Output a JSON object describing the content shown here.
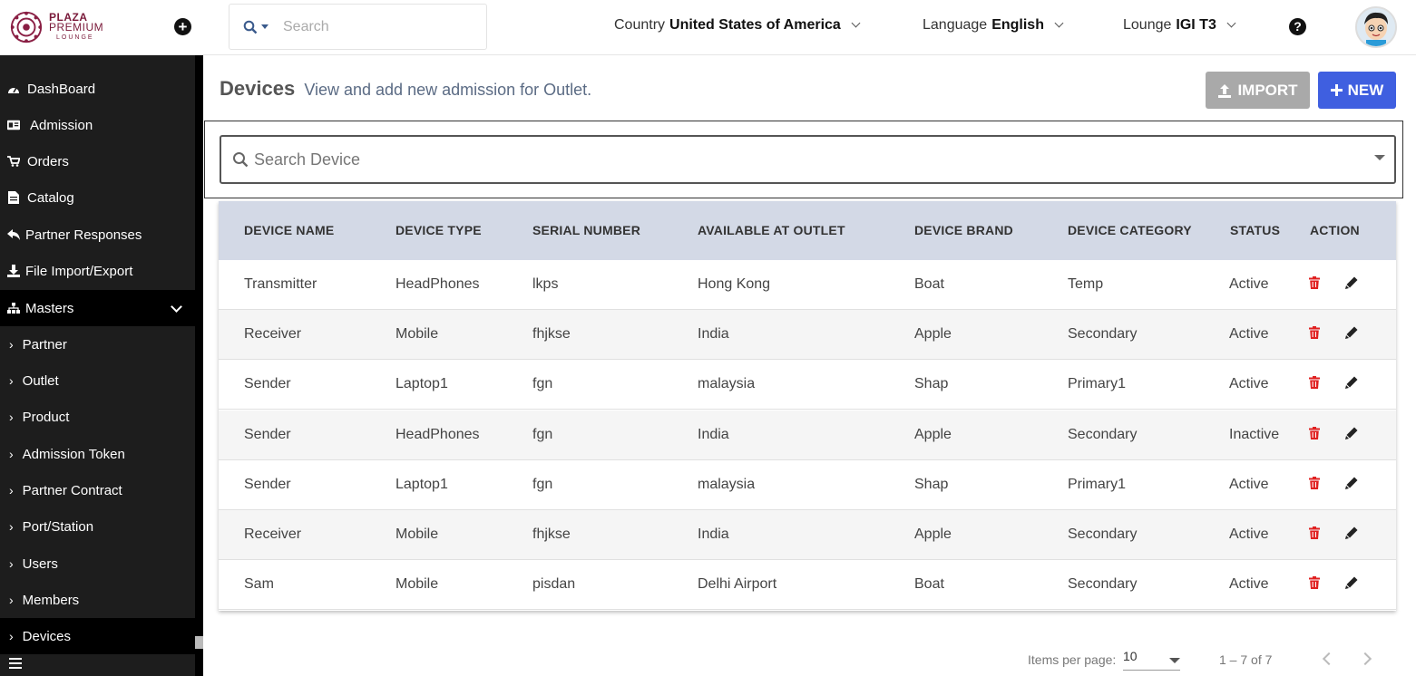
{
  "brand": {
    "line1": "PLAZA",
    "line2": "PREMIUM",
    "line3": "LOUNGE",
    "color": "#7a1a3a"
  },
  "header": {
    "search_placeholder": "Search",
    "country": {
      "label": "Country",
      "value": "United States of America"
    },
    "language": {
      "label": "Language",
      "value": "English"
    },
    "lounge": {
      "label": "Lounge",
      "value": "IGI T3"
    }
  },
  "sidebar": {
    "items": [
      {
        "label": "DashBoard",
        "icon": "dashboard-icon"
      },
      {
        "label": "Admission",
        "icon": "id-card-icon"
      },
      {
        "label": "Orders",
        "icon": "cart-icon"
      },
      {
        "label": "Catalog",
        "icon": "document-icon"
      },
      {
        "label": "Partner Responses",
        "icon": "reply-icon"
      },
      {
        "label": "File Import/Export",
        "icon": "download-icon"
      }
    ],
    "masters": {
      "label": "Masters",
      "icon": "sitemap-icon"
    },
    "sub_items": [
      {
        "label": "Partner"
      },
      {
        "label": "Outlet"
      },
      {
        "label": "Product"
      },
      {
        "label": "Admission Token"
      },
      {
        "label": "Partner Contract"
      },
      {
        "label": "Port/Station"
      },
      {
        "label": "Users"
      },
      {
        "label": "Members"
      },
      {
        "label": "Devices"
      }
    ]
  },
  "page": {
    "title": "Devices",
    "subtitle": "View and add new admission for Outlet.",
    "import_label": "IMPORT",
    "new_label": "NEW",
    "filter_placeholder": "Search Device"
  },
  "table": {
    "headers": [
      "DEVICE NAME",
      "DEVICE TYPE",
      "SERIAL NUMBER",
      "AVAILABLE AT OUTLET",
      "DEVICE BRAND",
      "DEVICE CATEGORY",
      "STATUS",
      "ACTION"
    ],
    "rows": [
      [
        "Transmitter",
        "HeadPhones",
        "lkps",
        "Hong Kong",
        "Boat",
        "Temp",
        "Active"
      ],
      [
        "Receiver",
        "Mobile",
        "fhjkse",
        "India",
        "Apple",
        "Secondary",
        "Active"
      ],
      [
        "Sender",
        "Laptop1",
        "fgn",
        "malaysia",
        "Shap",
        "Primary1",
        "Active"
      ],
      [
        "Sender",
        "HeadPhones",
        "fgn",
        "India",
        "Apple",
        "Secondary",
        "Inactive"
      ],
      [
        "Sender",
        "Laptop1",
        "fgn",
        "malaysia",
        "Shap",
        "Primary1",
        "Active"
      ],
      [
        "Receiver",
        "Mobile",
        "fhjkse",
        "India",
        "Apple",
        "Secondary",
        "Active"
      ],
      [
        "Sam",
        "Mobile",
        "pisdan",
        "Delhi Airport",
        "Boat",
        "Secondary",
        "Active"
      ]
    ]
  },
  "pagination": {
    "items_per_page_label": "Items per page:",
    "items_per_page": "10",
    "range": "1 – 7 of 7"
  },
  "colors": {
    "new_button": "#3f5fe0",
    "import_button": "#a9a9a9",
    "delete_icon": "#e02020",
    "table_header": "#d3d9e6",
    "sidebar": "#1d1d1d"
  }
}
